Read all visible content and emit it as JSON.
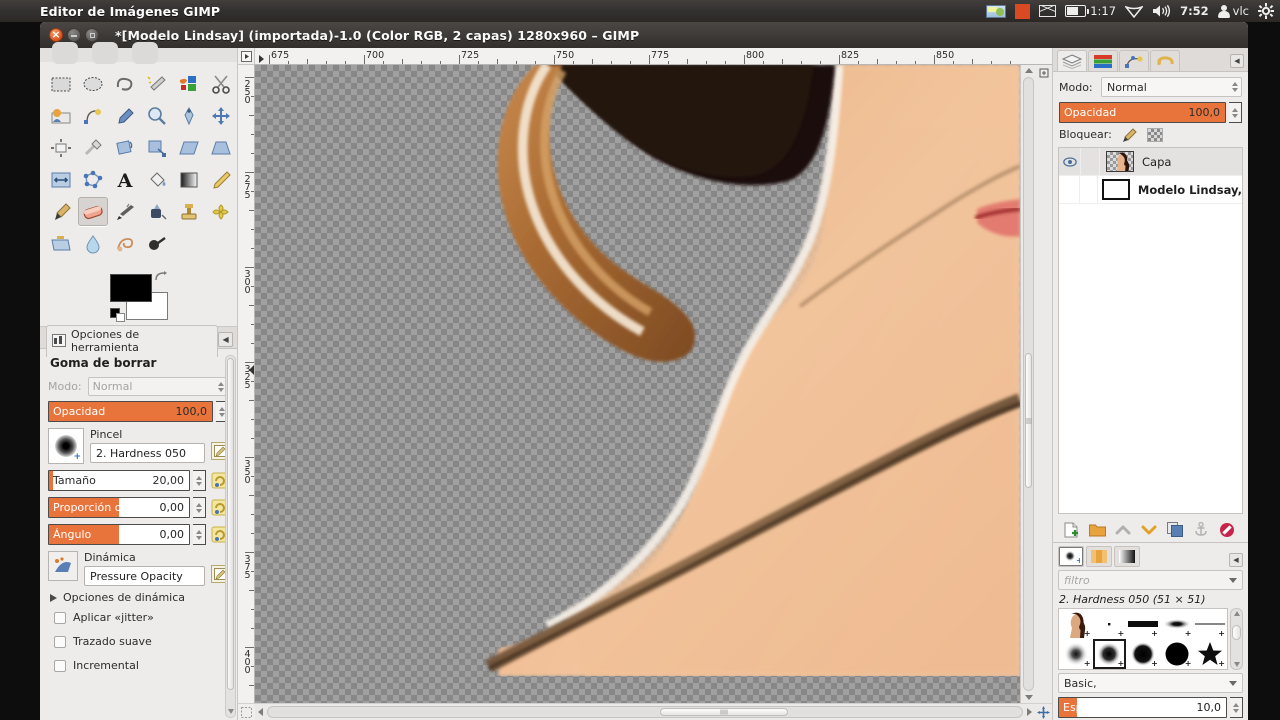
{
  "desktop": {
    "panel_title": "Editor de Imágenes GIMP",
    "tray": {
      "keyboard_icon": "keyboard-layout-icon",
      "red_icon": "recording-indicator-icon",
      "mail_icon": "messaging-envelope-icon",
      "battery_icon": "battery-icon",
      "battery_time": "1:17",
      "wifi_icon": "wifi-icon",
      "volume_icon": "volume-icon",
      "clock": "7:52",
      "user_icon": "user-icon",
      "user_name": "vlc",
      "power_icon": "system-gear-icon"
    }
  },
  "window": {
    "title": "*[Modelo  Lindsay] (importada)-1.0 (Color RGB, 2 capas) 1280x960 – GIMP",
    "buttons": {
      "close": "close-button",
      "minimize": "minimize-button",
      "maximize": "maximize-button"
    }
  },
  "toolbox": {
    "tools": [
      {
        "name": "rect-select-tool",
        "label": "Selección rectangular"
      },
      {
        "name": "ellipse-select-tool",
        "label": "Selección elíptica"
      },
      {
        "name": "free-select-tool",
        "label": "Selección libre"
      },
      {
        "name": "fuzzy-select-tool",
        "label": "Selección difusa"
      },
      {
        "name": "by-color-select-tool",
        "label": "Seleccionar por color"
      },
      {
        "name": "scissors-select-tool",
        "label": "Tijeras de selección"
      },
      {
        "name": "foreground-select-tool",
        "label": "Extracción de primer plano"
      },
      {
        "name": "paths-tool",
        "label": "Rutas"
      },
      {
        "name": "color-picker-tool",
        "label": "Recoge-color"
      },
      {
        "name": "zoom-tool",
        "label": "Ampliación"
      },
      {
        "name": "measure-tool",
        "label": "Medida"
      },
      {
        "name": "move-tool",
        "label": "Mover"
      },
      {
        "name": "align-tool",
        "label": "Alinear"
      },
      {
        "name": "crop-tool",
        "label": "Recortar"
      },
      {
        "name": "rotate-tool",
        "label": "Rotar"
      },
      {
        "name": "scale-tool",
        "label": "Escalar"
      },
      {
        "name": "shear-tool",
        "label": "Inclinar"
      },
      {
        "name": "perspective-tool",
        "label": "Perspectiva"
      },
      {
        "name": "flip-tool",
        "label": "Voltear"
      },
      {
        "name": "cage-transform-tool",
        "label": "Transformación de jaula"
      },
      {
        "name": "text-tool",
        "label": "Texto"
      },
      {
        "name": "bucket-fill-tool",
        "label": "Relleno de cubeta"
      },
      {
        "name": "gradient-tool",
        "label": "Degradado"
      },
      {
        "name": "pencil-tool",
        "label": "Lápiz"
      },
      {
        "name": "paintbrush-tool",
        "label": "Pincel"
      },
      {
        "name": "eraser-tool",
        "label": "Goma de borrar"
      },
      {
        "name": "airbrush-tool",
        "label": "Aerógrafo"
      },
      {
        "name": "ink-tool",
        "label": "Tinta"
      },
      {
        "name": "clone-tool",
        "label": "Clonar"
      },
      {
        "name": "heal-tool",
        "label": "Saneado"
      },
      {
        "name": "perspective-clone-tool",
        "label": "Clonar con perspectiva"
      },
      {
        "name": "blur-sharpen-tool",
        "label": "Desenfocar/enfocar"
      },
      {
        "name": "smudge-tool",
        "label": "Emborronar"
      },
      {
        "name": "dodge-burn-tool",
        "label": "Blanquear/ennegrecer"
      }
    ],
    "active_tool_index": 25,
    "foreground_color": "#000000",
    "background_color": "#ffffff"
  },
  "tool_options": {
    "tab_label": "Opciones de herramienta",
    "title": "Goma de borrar",
    "mode_label": "Modo:",
    "mode_value": "Normal",
    "opacity_label": "Opacidad",
    "opacity_value": "100,0",
    "brush_label": "Pincel",
    "brush_value": "2. Hardness 050",
    "size_label": "Tamaño",
    "size_value": "20,00",
    "aspect_label": "Proporción de...",
    "aspect_value": "0,00",
    "angle_label": "Ángulo",
    "angle_value": "0,00",
    "dynamics_label": "Dinámica",
    "dynamics_value": "Pressure Opacity",
    "dynamics_options_label": "Opciones de dinámica",
    "jitter_label": "Aplicar «jitter»",
    "smooth_label": "Trazado suave",
    "incremental_label": "Incremental",
    "accent_color": "#e8743b"
  },
  "canvas": {
    "h_ruler_ticks": [
      "675",
      "700",
      "725",
      "750",
      "775",
      "800",
      "825",
      "850"
    ],
    "v_ruler_ticks": [
      "250",
      "275",
      "300",
      "325",
      "350",
      "375",
      "400"
    ],
    "h_ruler_start": 675,
    "h_ruler_step": 25,
    "v_ruler_start": 250,
    "v_ruler_step": 25
  },
  "layers_dock": {
    "tabs": [
      {
        "name": "tab-layers",
        "label": "Capas"
      },
      {
        "name": "tab-channels",
        "label": "Canales"
      },
      {
        "name": "tab-paths",
        "label": "Rutas"
      },
      {
        "name": "tab-undo-history",
        "label": "Histórico de deshacer"
      }
    ],
    "active_tab": 0,
    "mode_label": "Modo:",
    "mode_value": "Normal",
    "opacity_label": "Opacidad",
    "opacity_value": "100,0",
    "lock_label": "Bloquear:",
    "layers": [
      {
        "name": "Capa",
        "selected": true,
        "visible": true,
        "thumb": "transparent"
      },
      {
        "name": "Modelo  Lindsay,",
        "selected": false,
        "visible": false,
        "thumb": "white"
      }
    ],
    "toolbar_buttons": [
      {
        "name": "new-layer-button",
        "label": "Capa nueva"
      },
      {
        "name": "new-layer-group-button",
        "label": "Grupo de capas nuevo"
      },
      {
        "name": "raise-layer-button",
        "label": "Elevar capa"
      },
      {
        "name": "lower-layer-button",
        "label": "Bajar capa"
      },
      {
        "name": "duplicate-layer-button",
        "label": "Duplicar capa"
      },
      {
        "name": "anchor-layer-button",
        "label": "Anclar capa"
      },
      {
        "name": "delete-layer-button",
        "label": "Eliminar capa"
      }
    ]
  },
  "brushes_dock": {
    "tabs": [
      {
        "name": "tab-brushes",
        "label": "Pinceles"
      },
      {
        "name": "tab-patterns",
        "label": "Patrones"
      },
      {
        "name": "tab-gradients",
        "label": "Degradados"
      }
    ],
    "active_tab": 0,
    "filter_placeholder": "filtro",
    "selected_brush": "2. Hardness 050 (51 × 51)",
    "brush_items": [
      {
        "name": "brush-thumbnail-photo",
        "kind": "image"
      },
      {
        "name": "brush-pixel",
        "kind": "dot-tiny"
      },
      {
        "name": "brush-hardness-100-bar",
        "kind": "bar-hard"
      },
      {
        "name": "brush-soft-bar",
        "kind": "bar-soft"
      },
      {
        "name": "brush-thin-line",
        "kind": "line"
      },
      {
        "name": "brush-hardness-025",
        "kind": "soft-circle"
      },
      {
        "name": "brush-hardness-050",
        "kind": "mid-circle",
        "selected": true
      },
      {
        "name": "brush-hardness-075",
        "kind": "harder-circle"
      },
      {
        "name": "brush-hardness-100",
        "kind": "hard-circle"
      },
      {
        "name": "brush-star",
        "kind": "star"
      }
    ],
    "group_value": "Basic,",
    "spacing_label": "Espaciado",
    "spacing_value": "10,0"
  }
}
